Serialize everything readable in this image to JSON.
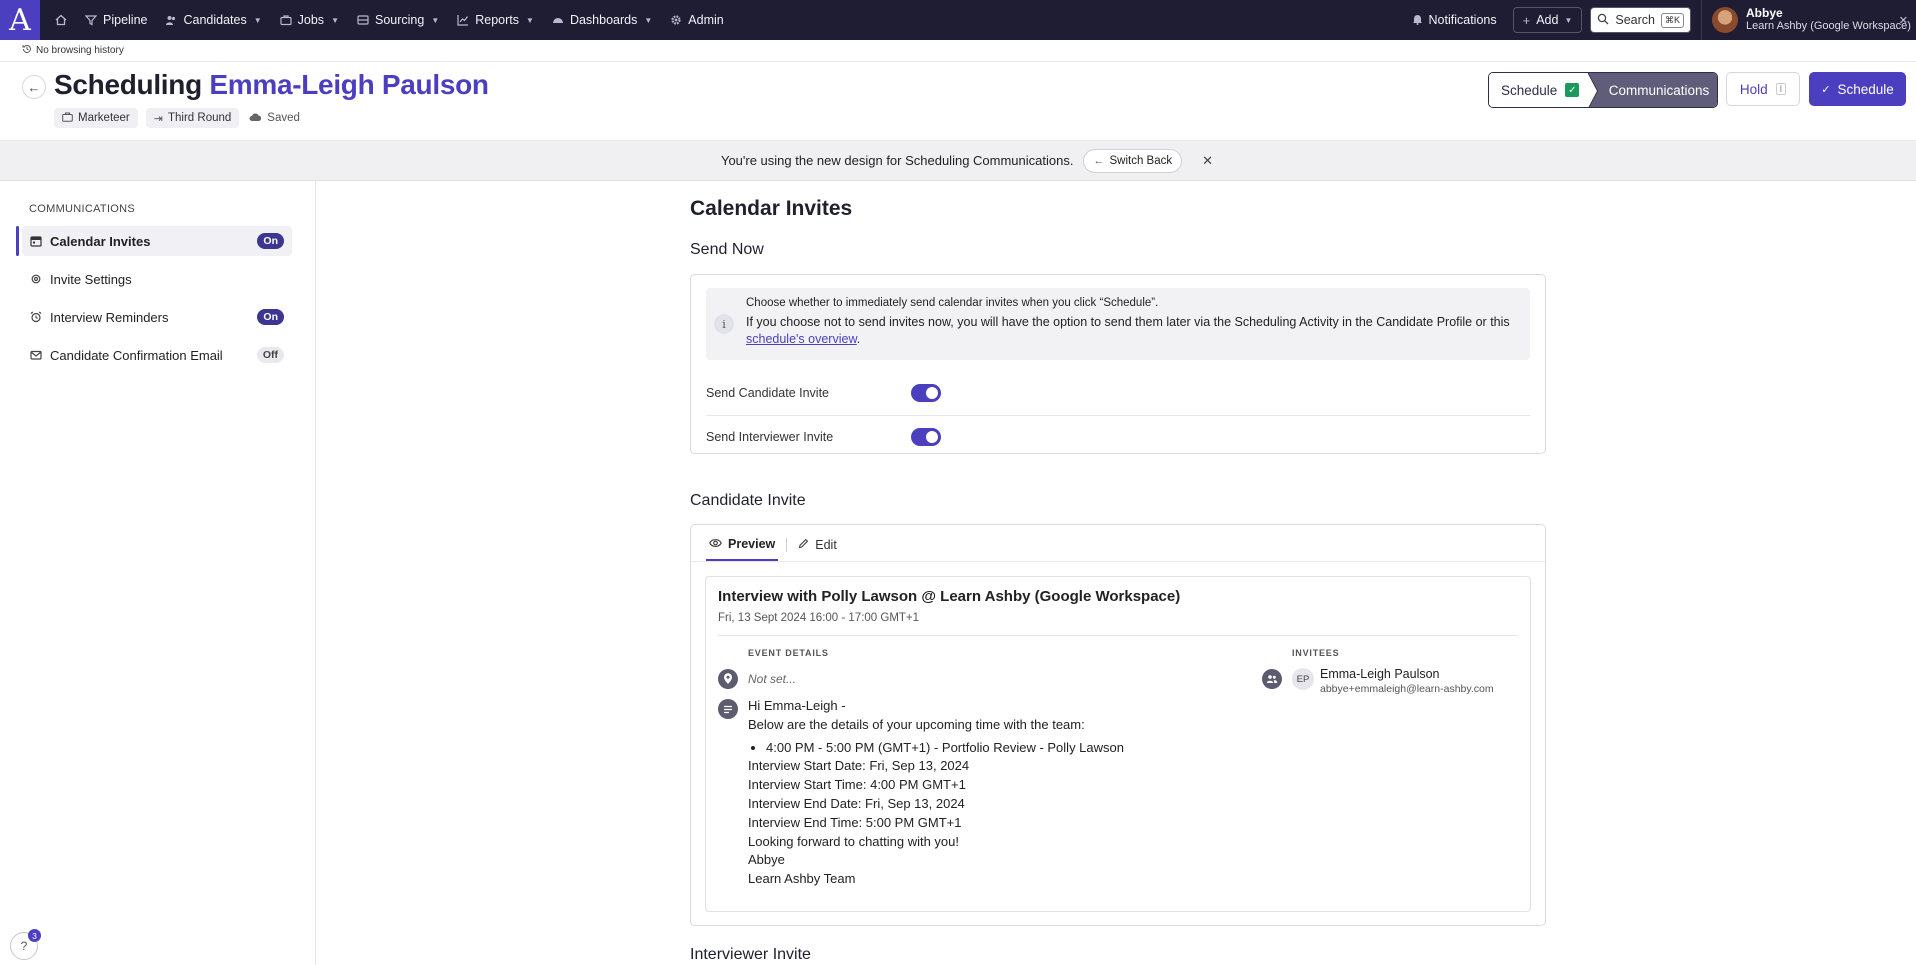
{
  "nav": {
    "logo": "A",
    "items": [
      {
        "label": "Pipeline",
        "chevron": false
      },
      {
        "label": "Candidates",
        "chevron": true
      },
      {
        "label": "Jobs",
        "chevron": true
      },
      {
        "label": "Sourcing",
        "chevron": true
      },
      {
        "label": "Reports",
        "chevron": true
      },
      {
        "label": "Dashboards",
        "chevron": true
      },
      {
        "label": "Admin",
        "chevron": false
      }
    ],
    "notifications": "Notifications",
    "add": "Add",
    "search": "Search",
    "search_shortcut": "⌘K",
    "user_name": "Abbye",
    "user_org": "Learn Ashby (Google Workspace)"
  },
  "history": "No browsing history",
  "header": {
    "title_prefix": "Scheduling",
    "candidate": "Emma-Leigh Paulson",
    "chip_role": "Marketeer",
    "chip_stage": "Third Round",
    "saved": "Saved",
    "step_schedule": "Schedule",
    "step_communications": "Communications",
    "hold": "Hold",
    "hold_key": "I",
    "schedule_button": "Schedule"
  },
  "banner": {
    "text": "You're using the new design for Scheduling Communications.",
    "switch_back": "Switch Back"
  },
  "sidebar": {
    "heading": "COMMUNICATIONS",
    "items": [
      {
        "label": "Calendar Invites",
        "badge": "On",
        "active": true
      },
      {
        "label": "Invite Settings",
        "badge": "",
        "active": false
      },
      {
        "label": "Interview Reminders",
        "badge": "On",
        "active": false
      },
      {
        "label": "Candidate Confirmation Email",
        "badge": "Off",
        "active": false
      }
    ],
    "help_count": "3"
  },
  "main": {
    "title": "Calendar Invites",
    "send_now": {
      "heading": "Send Now",
      "info_line1": "Choose whether to immediately send calendar invites when you click “Schedule”.",
      "info_line2": "If you choose not to send invites now, you will have the option to send them later via the Scheduling Activity in the Candidate Profile or this",
      "info_link": "schedule's overview",
      "send_candidate_label": "Send Candidate Invite",
      "send_candidate_on": true,
      "send_interviewer_label": "Send Interviewer Invite",
      "send_interviewer_on": true
    },
    "candidate_invite": {
      "heading": "Candidate Invite",
      "tab_preview": "Preview",
      "tab_edit": "Edit",
      "event_title": "Interview with Polly Lawson @ Learn Ashby (Google Workspace)",
      "event_time": "Fri, 13 Sept 2024 16:00 - 17:00 GMT+1",
      "event_details_label": "EVENT DETAILS",
      "location": "Not set...",
      "invitees_label": "INVITEES",
      "invitee_initials": "EP",
      "invitee_name": "Emma-Leigh Paulson",
      "invitee_email": "abbye+emmaleigh@learn-ashby.com",
      "greeting": "Hi Emma-Leigh -",
      "intro": "Below are the details of your upcoming time with the team:",
      "bullet": "4:00 PM - 5:00 PM (GMT+1) - Portfolio Review - Polly Lawson",
      "start_date": "Interview Start Date: Fri, Sep 13, 2024",
      "start_time": "Interview Start Time: 4:00 PM GMT+1",
      "end_date": "Interview End Date: Fri, Sep 13, 2024",
      "end_time": "Interview End Time: 5:00 PM GMT+1",
      "closing": "Looking forward to chatting with you!",
      "sign_name": "Abbye",
      "sign_team": "Learn Ashby Team"
    },
    "interviewer_invite_heading": "Interviewer Invite"
  }
}
